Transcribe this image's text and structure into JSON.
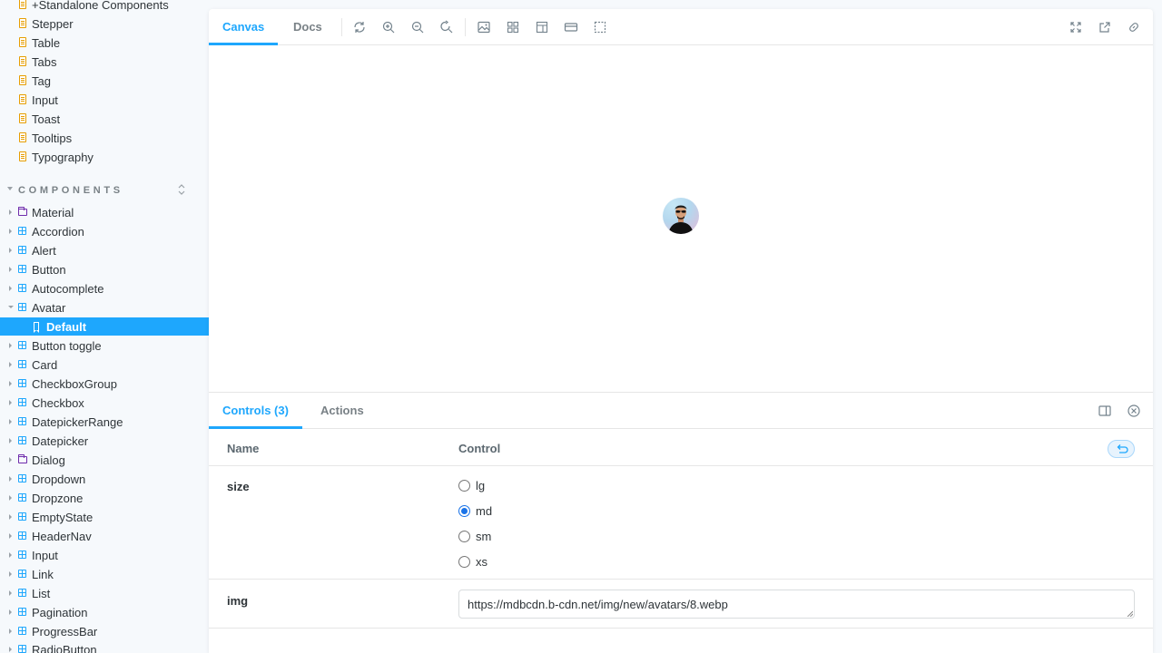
{
  "sidebar": {
    "docs": [
      {
        "label": "+Standalone Components"
      },
      {
        "label": "Stepper"
      },
      {
        "label": "Table"
      },
      {
        "label": "Tabs"
      },
      {
        "label": "Tag"
      },
      {
        "label": "Input"
      },
      {
        "label": "Toast"
      },
      {
        "label": "Tooltips"
      },
      {
        "label": "Typography"
      }
    ],
    "section_title": "COMPONENTS",
    "components": [
      {
        "label": "Material",
        "icon": "folder-icon"
      },
      {
        "label": "Accordion",
        "icon": "component-icon"
      },
      {
        "label": "Alert",
        "icon": "component-icon"
      },
      {
        "label": "Button",
        "icon": "component-icon"
      },
      {
        "label": "Autocomplete",
        "icon": "component-icon"
      },
      {
        "label": "Avatar",
        "icon": "component-icon",
        "expanded": true
      },
      {
        "label": "Button toggle",
        "icon": "component-icon"
      },
      {
        "label": "Card",
        "icon": "component-icon"
      },
      {
        "label": "CheckboxGroup",
        "icon": "component-icon"
      },
      {
        "label": "Checkbox",
        "icon": "component-icon"
      },
      {
        "label": "DatepickerRange",
        "icon": "component-icon"
      },
      {
        "label": "Datepicker",
        "icon": "component-icon"
      },
      {
        "label": "Dialog",
        "icon": "folder-icon"
      },
      {
        "label": "Dropdown",
        "icon": "component-icon"
      },
      {
        "label": "Dropzone",
        "icon": "component-icon"
      },
      {
        "label": "EmptyState",
        "icon": "component-icon"
      },
      {
        "label": "HeaderNav",
        "icon": "component-icon"
      },
      {
        "label": "Input",
        "icon": "component-icon"
      },
      {
        "label": "Link",
        "icon": "component-icon"
      },
      {
        "label": "List",
        "icon": "component-icon"
      },
      {
        "label": "Pagination",
        "icon": "component-icon"
      },
      {
        "label": "ProgressBar",
        "icon": "component-icon"
      },
      {
        "label": "RadioButton",
        "icon": "component-icon"
      }
    ],
    "selected_story": "Default"
  },
  "toolbar": {
    "tabs": [
      {
        "label": "Canvas",
        "active": true
      },
      {
        "label": "Docs",
        "active": false
      }
    ],
    "tools": [
      "refresh-icon",
      "zoom-in-icon",
      "zoom-out-icon",
      "zoom-reset-icon",
      "background-icon",
      "grid-icon",
      "measure-icon",
      "outline-icon",
      "viewport-icon"
    ],
    "right_tools": [
      "fullscreen-icon",
      "open-new-tab-icon",
      "copy-link-icon"
    ]
  },
  "addons": {
    "tabs": [
      {
        "label": "Controls (3)",
        "active": true
      },
      {
        "label": "Actions",
        "active": false
      }
    ],
    "columns": {
      "name": "Name",
      "control": "Control"
    },
    "props": {
      "size": {
        "name": "size",
        "options": [
          "lg",
          "md",
          "sm",
          "xs"
        ],
        "selected": "md"
      },
      "img": {
        "name": "img",
        "value": "https://mdbcdn.b-cdn.net/img/new/avatars/8.webp"
      }
    }
  },
  "colors": {
    "accent": "#1ea7fd",
    "doc_icon": "#e69d00",
    "folder_icon": "#6f2cac",
    "background": "#f6f9fc"
  }
}
